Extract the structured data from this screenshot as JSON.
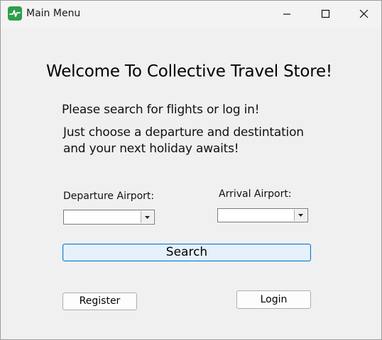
{
  "window": {
    "title": "Main Menu",
    "icon": "pulse-app-icon",
    "controls": {
      "minimize": "minimize-icon",
      "maximize": "maximize-icon",
      "close": "close-icon"
    }
  },
  "content": {
    "heading": "Welcome To Collective Travel Store!",
    "intro_line1": "Please search for flights or log in!",
    "intro_line2": "Just choose a departure and destintation",
    "intro_line3": "and your next holiday awaits!"
  },
  "form": {
    "departure_label": "Departure Airport:",
    "departure_value": "",
    "arrival_label": "Arrival Airport:",
    "arrival_value": "",
    "search_label": "Search"
  },
  "actions": {
    "register_label": "Register",
    "login_label": "Login"
  },
  "colors": {
    "app_icon": "#2e9f4a",
    "search_focus_border": "#0078d7",
    "search_fill": "#e5f1fb",
    "window_bg": "#f0f0f0"
  }
}
